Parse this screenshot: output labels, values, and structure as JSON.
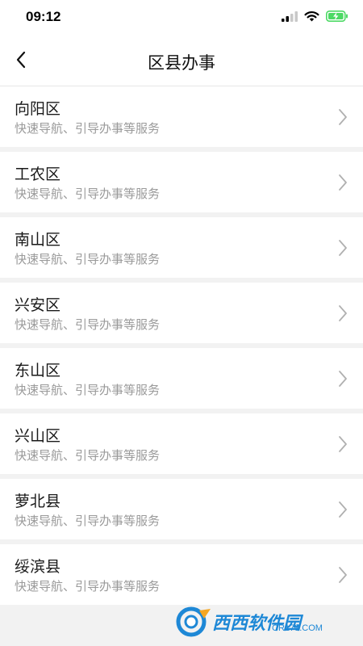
{
  "status_bar": {
    "time": "09:12"
  },
  "nav": {
    "title": "区县办事"
  },
  "districts": [
    {
      "name": "向阳区",
      "desc": "快速导航、引导办事等服务"
    },
    {
      "name": "工农区",
      "desc": "快速导航、引导办事等服务"
    },
    {
      "name": "南山区",
      "desc": "快速导航、引导办事等服务"
    },
    {
      "name": "兴安区",
      "desc": "快速导航、引导办事等服务"
    },
    {
      "name": "东山区",
      "desc": "快速导航、引导办事等服务"
    },
    {
      "name": "兴山区",
      "desc": "快速导航、引导办事等服务"
    },
    {
      "name": "萝北县",
      "desc": "快速导航、引导办事等服务"
    },
    {
      "name": "绥滨县",
      "desc": "快速导航、引导办事等服务"
    }
  ],
  "watermark": {
    "text": "西西软件园",
    "sub": "CR173.COM"
  },
  "colors": {
    "accent": "#1e88d6",
    "battery": "#4cd964"
  }
}
